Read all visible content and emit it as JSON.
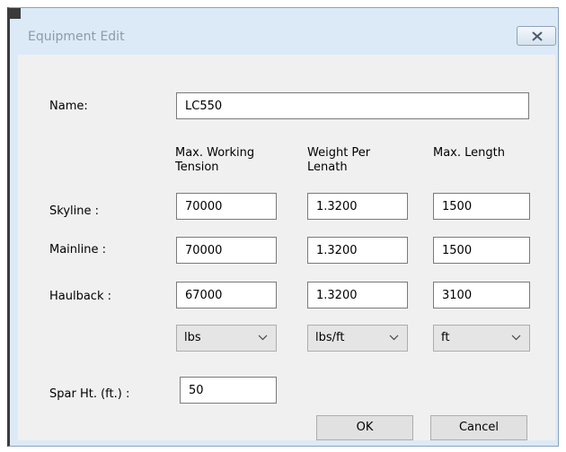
{
  "window": {
    "title": "Equipment Edit"
  },
  "form": {
    "name_label": "Name:",
    "name_value": "LC550",
    "col_tension_line1": "Max. Working",
    "col_tension_line2": "Tension",
    "col_weight_line1": "Weight Per",
    "col_weight_line2": "Lenath",
    "col_length": "Max. Length",
    "rows": [
      {
        "label": "Skyline :",
        "tension": "70000",
        "weight": "1.3200",
        "length": "1500"
      },
      {
        "label": "Mainline :",
        "tension": "70000",
        "weight": "1.3200",
        "length": "1500"
      },
      {
        "label": "Haulback :",
        "tension": "67000",
        "weight": "1.3200",
        "length": "3100"
      }
    ],
    "units": {
      "tension": "lbs",
      "weight": "lbs/ft",
      "length": "ft"
    },
    "spar_label": "Spar Ht. (ft.) :",
    "spar_value": "50"
  },
  "buttons": {
    "ok": "OK",
    "cancel": "Cancel"
  },
  "icons": {
    "close": "close-icon",
    "dropdown": "chevron-down-icon"
  },
  "colors": {
    "frame": "#dceaf7",
    "client": "#f0f0f0",
    "title_text": "#8c9aab"
  }
}
